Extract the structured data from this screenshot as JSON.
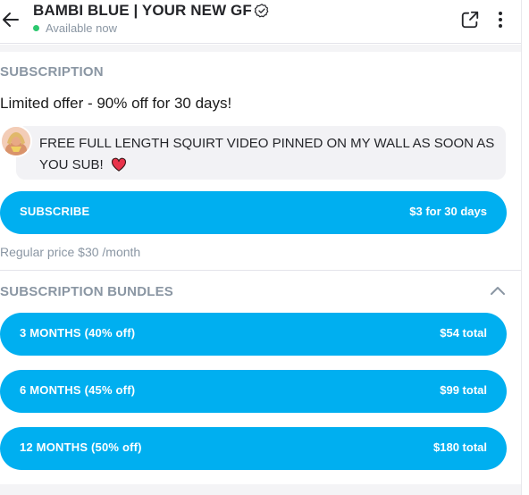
{
  "header": {
    "title": "BAMBI BLUE | YOUR NEW GF",
    "status": "Available now"
  },
  "subscription": {
    "section_label": "SUBSCRIPTION",
    "offer_title": "Limited offer - 90% off for 30 days!",
    "message": "FREE FULL LENGTH SQUIRT VIDEO PINNED ON MY WALL AS SOON AS YOU SUB!",
    "subscribe_label": "SUBSCRIBE",
    "subscribe_price": "$3 for 30 days",
    "regular_price": "Regular price $30 /month"
  },
  "bundles": {
    "section_label": "SUBSCRIPTION BUNDLES",
    "items": [
      {
        "label": "3 MONTHS (40% off)",
        "price": "$54 total"
      },
      {
        "label": "6 MONTHS (45% off)",
        "price": "$99 total"
      },
      {
        "label": "12 MONTHS (50% off)",
        "price": "$180 total"
      }
    ]
  },
  "colors": {
    "accent": "#00aff0",
    "online": "#2cc86f",
    "muted": "#8a96a3"
  },
  "icons": [
    "back-arrow-icon",
    "verified-icon",
    "share-icon",
    "more-vertical-icon",
    "heart-icon",
    "chevron-up-icon"
  ]
}
